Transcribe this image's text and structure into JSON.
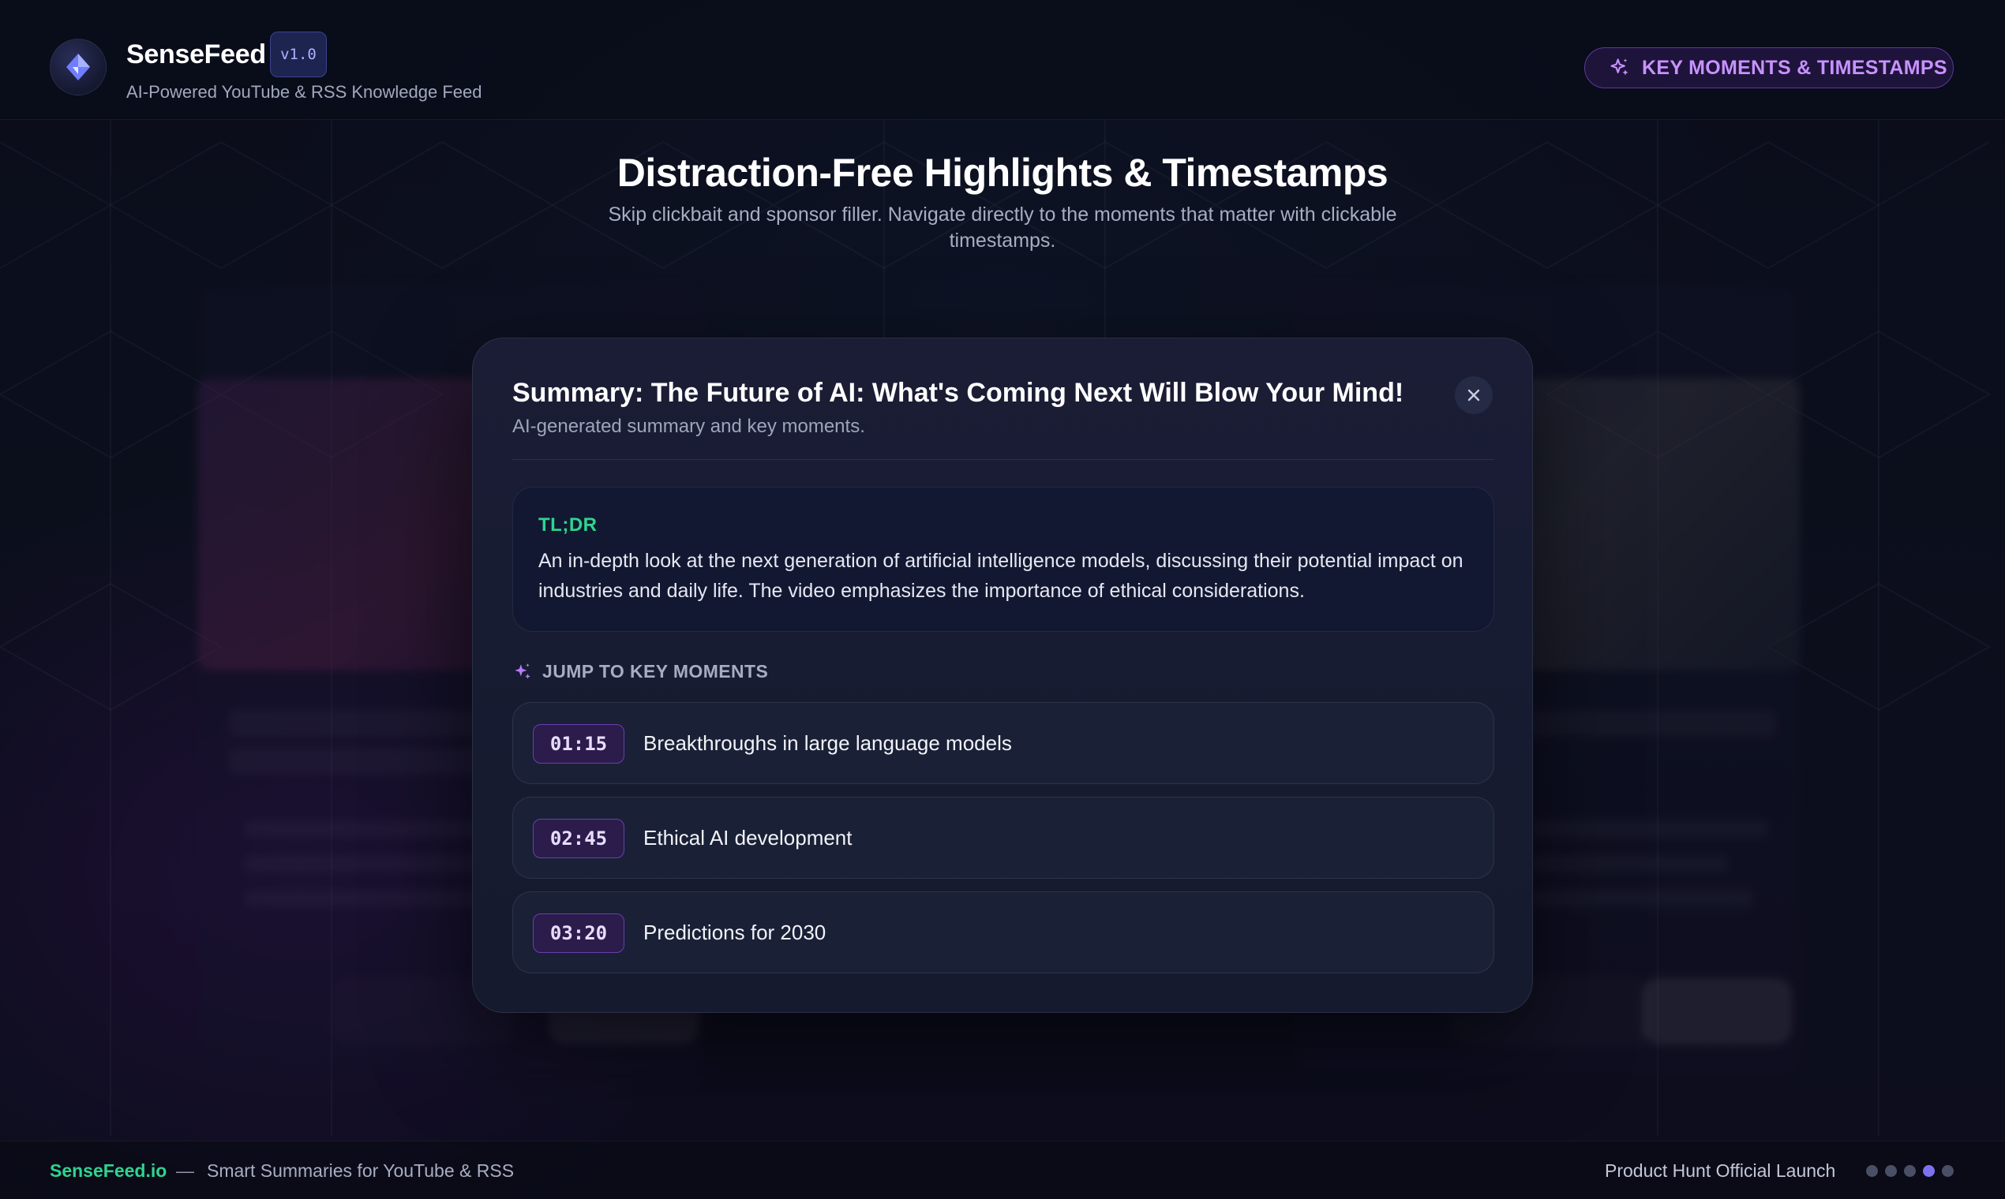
{
  "header": {
    "brand_name": "SenseFeed",
    "version": "v1.0",
    "tagline": "AI-Powered YouTube & RSS Knowledge Feed",
    "pill_label": "KEY MOMENTS & TIMESTAMPS"
  },
  "hero": {
    "title": "Distraction-Free Highlights & Timestamps",
    "subtitle": "Skip clickbait and sponsor filler. Navigate directly to the moments that matter with clickable timestamps."
  },
  "modal": {
    "title": "Summary: The Future of AI: What's Coming Next Will Blow Your Mind!",
    "subtitle": "AI-generated summary and key moments.",
    "tldr_label": "TL;DR",
    "tldr_text": "An in-depth look at the next generation of artificial intelligence models, discussing their potential impact on industries and daily life. The video emphasizes the importance of ethical considerations.",
    "key_moments_label": "JUMP TO KEY MOMENTS",
    "moments": [
      {
        "time": "01:15",
        "label": "Breakthroughs in large language models"
      },
      {
        "time": "02:45",
        "label": "Ethical AI development"
      },
      {
        "time": "03:20",
        "label": "Predictions for 2030"
      }
    ]
  },
  "footer": {
    "brand": "SenseFeed.io",
    "separator": "—",
    "tagline": "Smart Summaries for YouTube & RSS",
    "right_text": "Product Hunt Official Launch",
    "active_dot": 3
  },
  "colors": {
    "accent_green": "#2fd48f",
    "accent_purple": "#c792ff",
    "background": "#0c0e1b"
  }
}
